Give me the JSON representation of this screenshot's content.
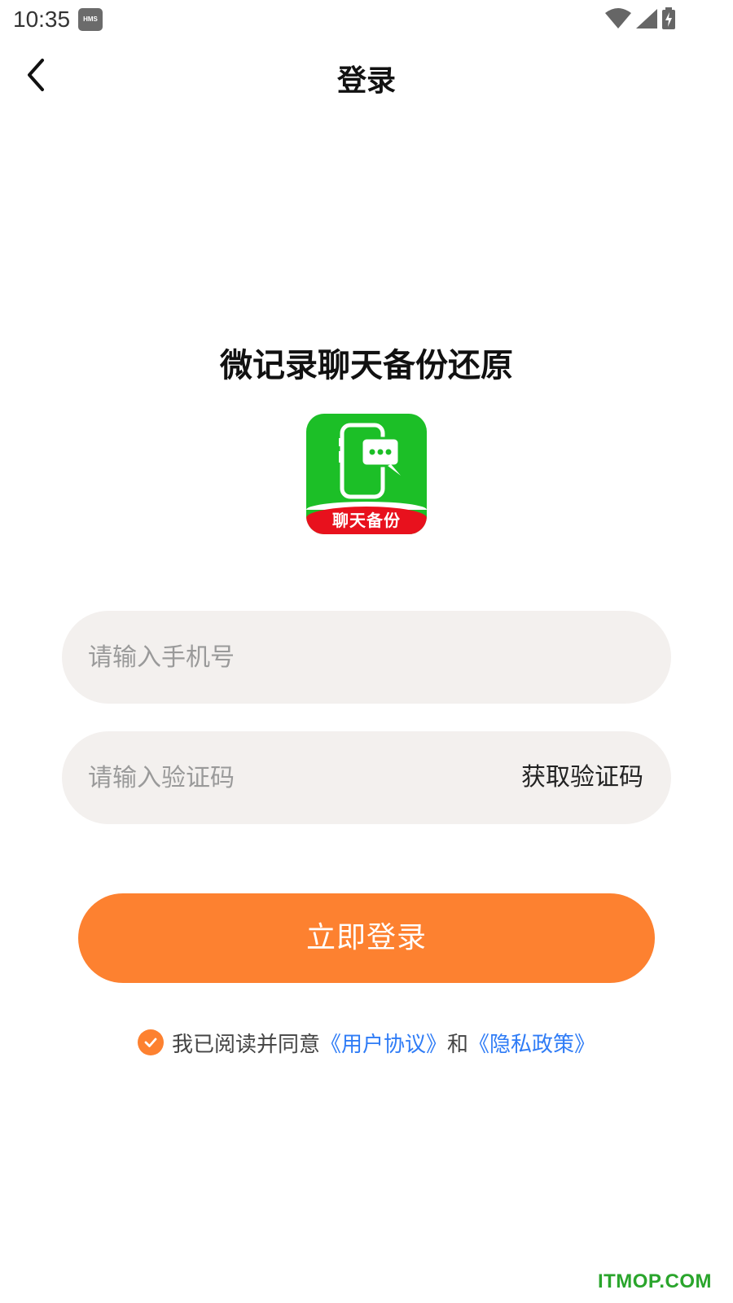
{
  "status_bar": {
    "time": "10:35",
    "badge": "HMS"
  },
  "nav": {
    "title": "登录"
  },
  "app": {
    "name": "微记录聊天备份还原",
    "logo_band_text": "聊天备份"
  },
  "form": {
    "phone_placeholder": "请输入手机号",
    "code_placeholder": "请输入验证码",
    "get_code_label": "获取验证码",
    "login_label": "立即登录"
  },
  "agreement": {
    "checked": true,
    "prefix": "我已阅读并同意",
    "user_agreement": "《用户协议》",
    "and": "和",
    "privacy_policy": "《隐私政策》"
  },
  "colors": {
    "accent": "#fd8130",
    "link": "#2f7cf6",
    "input_bg": "#f3f0ee",
    "logo_green": "#1cbf27",
    "logo_red": "#e8111d"
  },
  "watermark": "ITMOP.COM"
}
